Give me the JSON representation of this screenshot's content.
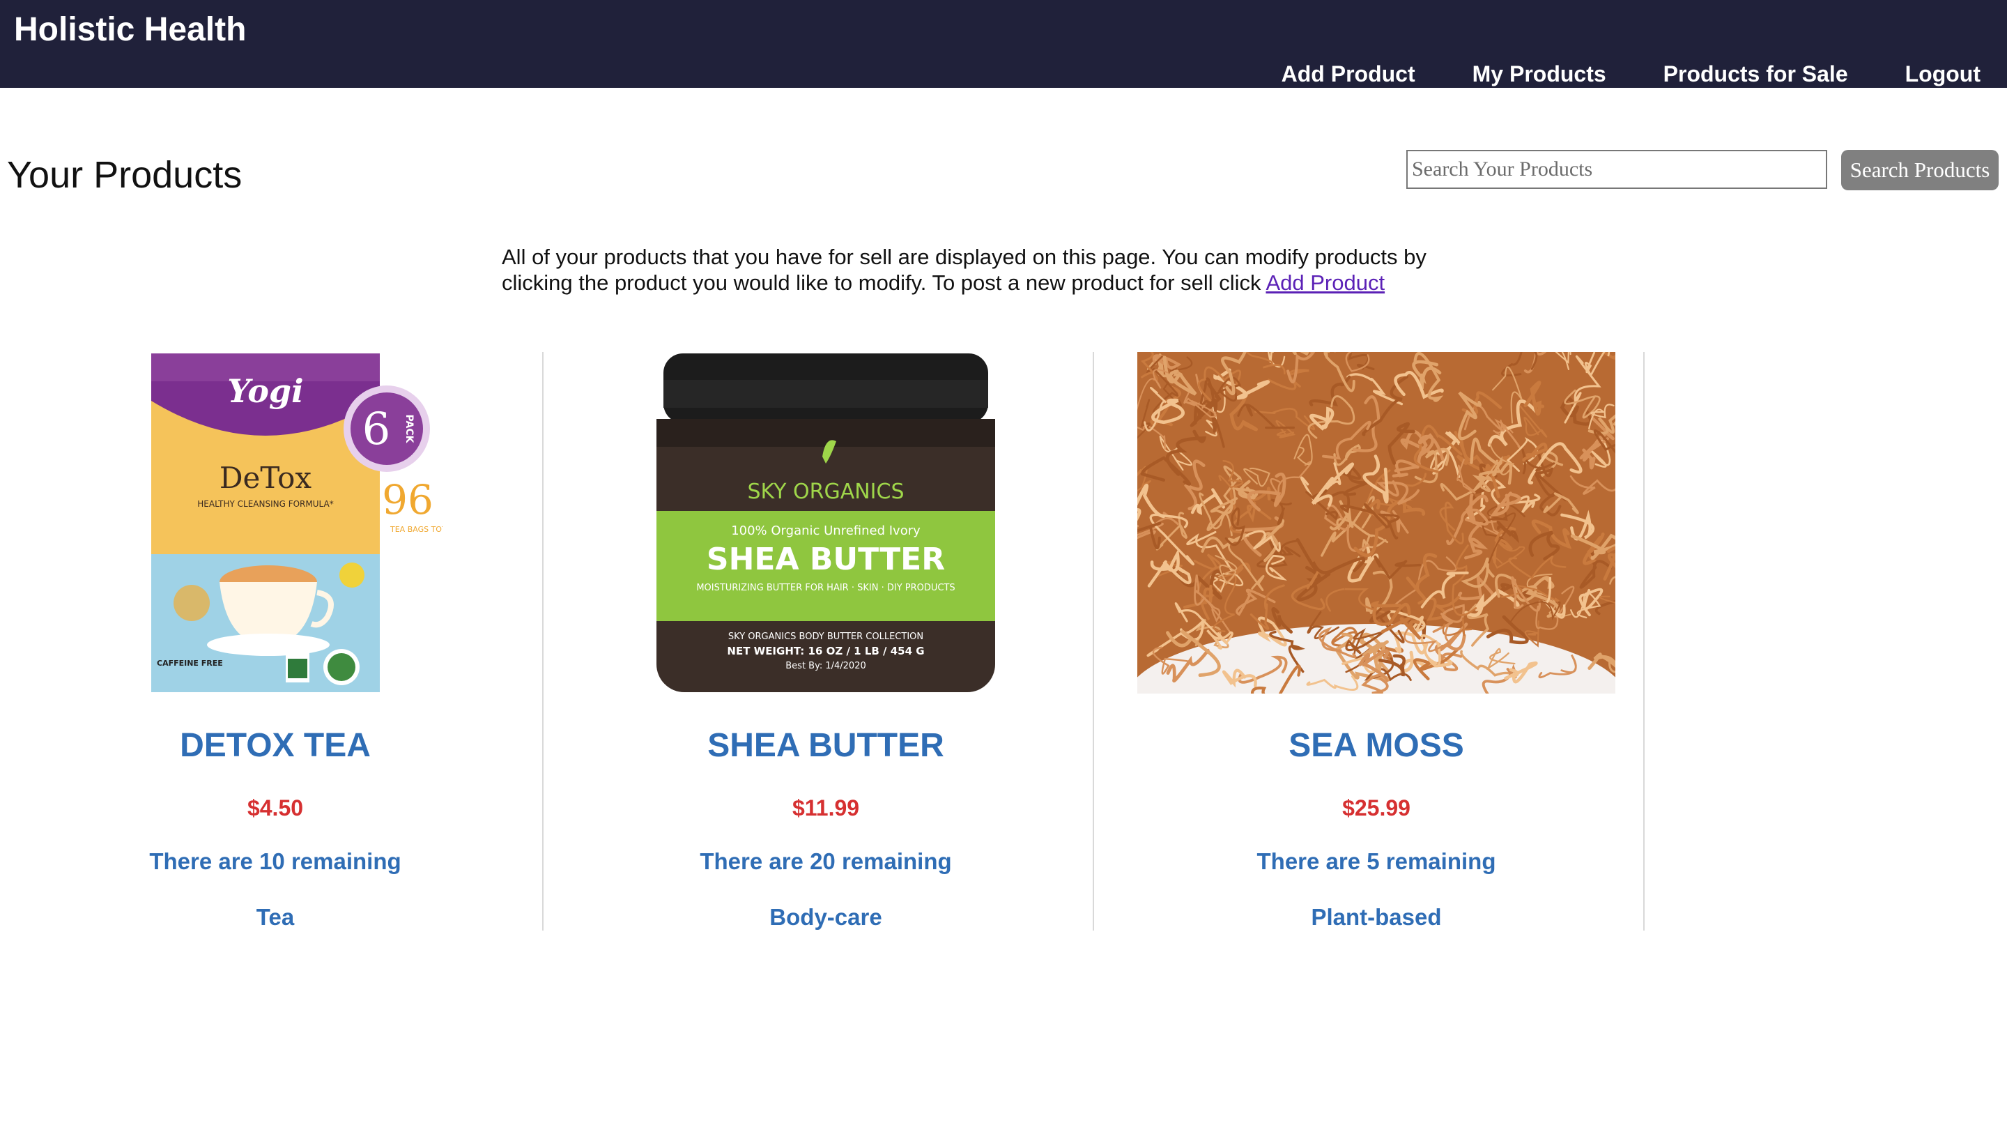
{
  "app": {
    "brand": "Holistic Health"
  },
  "nav": {
    "items": [
      {
        "label": "Add Product"
      },
      {
        "label": "My Products"
      },
      {
        "label": "Products for Sale"
      },
      {
        "label": "Logout"
      }
    ]
  },
  "page": {
    "title": "Your Products",
    "intro": "All of your products that you have for sell are displayed on this page. You can modify products by clicking the product you would like to modify. To post a new product for sell click ",
    "intro_link": "Add Product"
  },
  "search": {
    "placeholder": "Search Your Products",
    "value": "",
    "button_label": "Search Products"
  },
  "products": [
    {
      "name": "DETOX TEA",
      "price": "$4.50",
      "stock": "There are 10 remaining",
      "category": "Tea",
      "image": {
        "brand": "Yogi",
        "product": "DeTox",
        "tagline": "HEALTHY CLEANSING FORMULA*",
        "pack": "6",
        "pack_label": "PACK",
        "count": "96",
        "count_label": "TEA BAGS TOTAL",
        "footer": "CAFFEINE FREE"
      }
    },
    {
      "name": "SHEA BUTTER",
      "price": "$11.99",
      "stock": "There are 20 remaining",
      "category": "Body-care",
      "image": {
        "brand": "SKY ORGANICS",
        "line1": "100% Organic Unrefined Ivory",
        "title": "SHEA BUTTER",
        "line2": "MOISTURIZING BUTTER FOR HAIR · SKIN · DIY PRODUCTS",
        "line3": "SKY ORGANICS BODY BUTTER COLLECTION",
        "line4": "NET WEIGHT: 16 OZ / 1 LB / 454 G",
        "line5": "Best By: 1/4/2020"
      }
    },
    {
      "name": "SEA MOSS",
      "price": "$25.99",
      "stock": "There are 5 remaining",
      "category": "Plant-based",
      "image": {}
    }
  ],
  "colors": {
    "header_bg": "#20213a",
    "product_text": "#2f6db5",
    "price": "#d63031",
    "link": "#5b21b6",
    "search_button": "#808080"
  }
}
